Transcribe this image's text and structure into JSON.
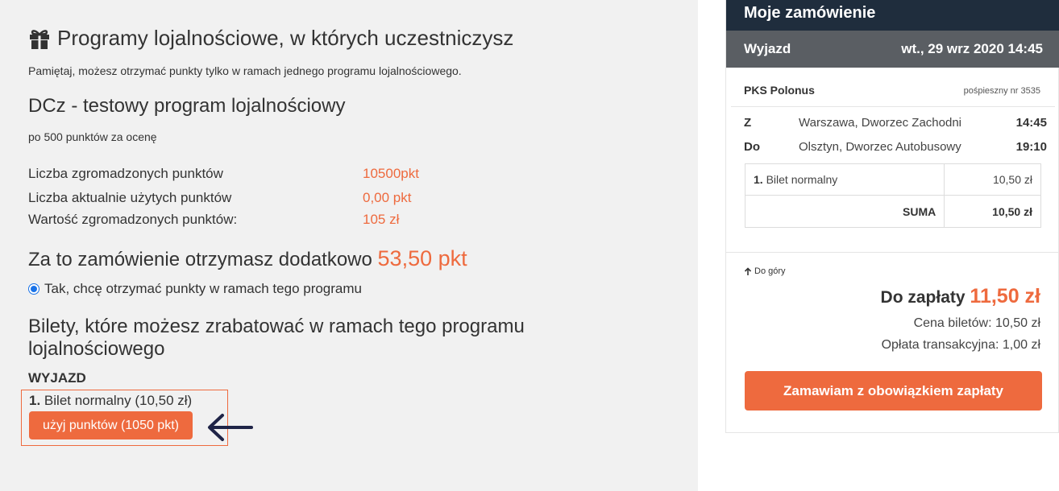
{
  "loyalty": {
    "title": "Programy lojalnościowe, w których uczestniczysz",
    "note": "Pamiętaj, możesz otrzymać punkty tylko w ramach jednego programu lojalnościowego.",
    "program": {
      "name": "DCz - testowy program lojalnościowy",
      "description": "po 500 punktów za ocenę",
      "stats": [
        {
          "label": "Liczba zgromadzonych punktów",
          "value": "10500pkt"
        },
        {
          "label": "Liczba aktualnie użytych punktów",
          "value": "0,00 pkt"
        },
        {
          "label": "Wartość zgromadzonych punktów:",
          "value": "105 zł"
        }
      ],
      "earn_text": "Za to zamówienie otrzymasz dodatkowo",
      "earn_points": "53,50 pkt",
      "radio_label": "Tak, chcę otrzymać punkty w ramach tego programu",
      "radio_checked": true,
      "tickets_heading": "Bilety, które możesz zrabatować w ramach tego programu lojalnościowego",
      "direction": "WYJAZD",
      "ticket_number": "1.",
      "ticket_name": "Bilet normalny (10,50 zł)",
      "use_points_button": "użyj punktów (1050 pkt)"
    }
  },
  "order": {
    "header": "Moje zamówienie",
    "direction": "Wyjazd",
    "datetime": "wt., 29 wrz 2020 14:45",
    "carrier": "PKS Polonus",
    "train_no": "pośpieszny nr 3535",
    "route": [
      {
        "label": "Z",
        "station": "Warszawa, Dworzec Zachodni",
        "time": "14:45"
      },
      {
        "label": "Do",
        "station": "Olsztyn, Dworzec Autobusowy",
        "time": "19:10"
      }
    ],
    "ticket_number": "1.",
    "ticket_name": "Bilet normalny",
    "ticket_price": "10,50 zł",
    "sum_label": "SUMA",
    "sum_value": "10,50 zł",
    "back_to_top": "Do góry",
    "pay_label": "Do zapłaty",
    "pay_amount": "11,50 zł",
    "ticket_cost_line": "Cena biletów: 10,50 zł",
    "fee_line": "Opłata transakcyjna: 1,00 zł",
    "order_button": "Zamawiam z obowiązkiem zapłaty"
  },
  "colors": {
    "accent": "#ee6a3e",
    "header_dark": "#1f2d3d",
    "subheader_gray": "#5a5e63",
    "main_bg": "#f1f1f1",
    "radio_blue": "#1a73e8",
    "arrow_navy": "#1f2447"
  },
  "icons": {
    "title_icon": "gift-icon",
    "annotation": "arrow-left-icon",
    "back_to_top": "arrow-up-icon"
  }
}
